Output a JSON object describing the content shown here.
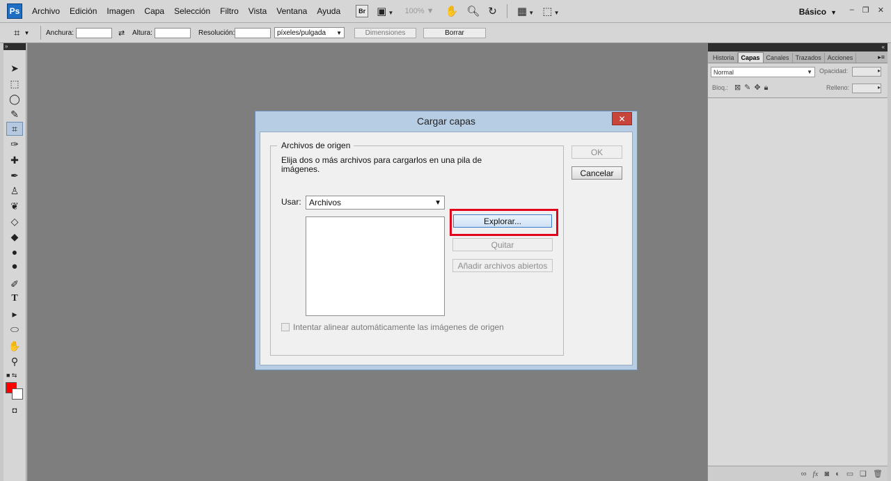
{
  "app": {
    "logo": "Ps",
    "menu": [
      "Archivo",
      "Edición",
      "Imagen",
      "Capa",
      "Selección",
      "Filtro",
      "Vista",
      "Ventana",
      "Ayuda"
    ],
    "bridge_label": "Br",
    "zoom": "100%",
    "workspace": "Básico"
  },
  "options": {
    "width_label": "Anchura:",
    "height_label": "Altura:",
    "resolution_label": "Resolución:",
    "units": "píxeles/pulgada",
    "dimensions_button": "Dimensiones",
    "clear_button": "Borrar"
  },
  "panel": {
    "tabs": [
      "Historia",
      "Capas",
      "Canales",
      "Trazados",
      "Acciones"
    ],
    "active_tab": "Capas",
    "blend_mode": "Normal",
    "opacity_label": "Opacidad:",
    "lock_label": "Bloq.:",
    "fill_label": "Relleno:",
    "footer_icons": [
      "link-icon",
      "fx-icon",
      "mask-icon",
      "adjustment-icon",
      "group-icon",
      "new-layer-icon",
      "trash-icon"
    ]
  },
  "toolbar": {
    "active_tool": "crop-tool",
    "foreground_color": "#ff0000",
    "background_color": "#ffffff"
  },
  "dialog": {
    "title": "Cargar capas",
    "group_title": "Archivos de origen",
    "description": "Elija dos o más archivos para cargarlos en una pila de imágenes.",
    "usar_label": "Usar:",
    "usar_value": "Archivos",
    "ok_button": "OK",
    "cancel_button": "Cancelar",
    "browse_button": "Explorar...",
    "remove_button": "Quitar",
    "add_open_button": "Añadir archivos abiertos",
    "align_checkbox_label": "Intentar alinear automáticamente las imágenes de origen",
    "align_checked": false,
    "highlight_color": "#e3001b"
  }
}
